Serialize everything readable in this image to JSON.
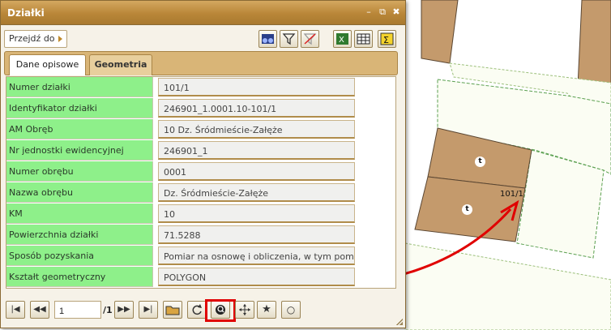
{
  "window": {
    "title": "Działki",
    "btn_min": "–",
    "btn_popout": "⧉",
    "btn_close": "✖"
  },
  "toolbar": {
    "goto_label": "Przejdź do",
    "buttons": [
      "binoculars-icon",
      "filter-icon",
      "clear-filter-icon",
      "excel-icon",
      "table-icon",
      "sum-icon"
    ]
  },
  "tabs": [
    {
      "label": "Dane opisowe",
      "active": true
    },
    {
      "label": "Geometria",
      "active": false
    }
  ],
  "fields": [
    {
      "label": "Numer działki",
      "value": "101/1"
    },
    {
      "label": "Identyfikator działki",
      "value": "246901_1.0001.10-101/1"
    },
    {
      "label": "AM Obręb",
      "value": "10  Dz. Śródmieście-Załęże"
    },
    {
      "label": "Nr jednostki ewidencyjnej",
      "value": "246901_1"
    },
    {
      "label": "Numer obrębu",
      "value": "0001"
    },
    {
      "label": "Nazwa obrębu",
      "value": "Dz. Śródmieście-Załęże"
    },
    {
      "label": "KM",
      "value": "10"
    },
    {
      "label": "Powierzchnia działki",
      "value": "71.5288"
    },
    {
      "label": "Sposób pozyskania",
      "value": "Pomiar na osnowę i obliczenia, w tym pomiary GPS"
    },
    {
      "label": "Kształt geometryczny",
      "value": "POLYGON"
    }
  ],
  "pager": {
    "current": "1",
    "total": "/1"
  },
  "footer_buttons": {
    "first": "|◀",
    "prev": "◀◀",
    "next": "▶▶",
    "last": "▶|",
    "star": "★",
    "circle": "○"
  },
  "map": {
    "parcel_label": "101/1",
    "symbol": "t",
    "colors": {
      "parcel": "#c49a6c",
      "highlight": "#e00000"
    }
  }
}
